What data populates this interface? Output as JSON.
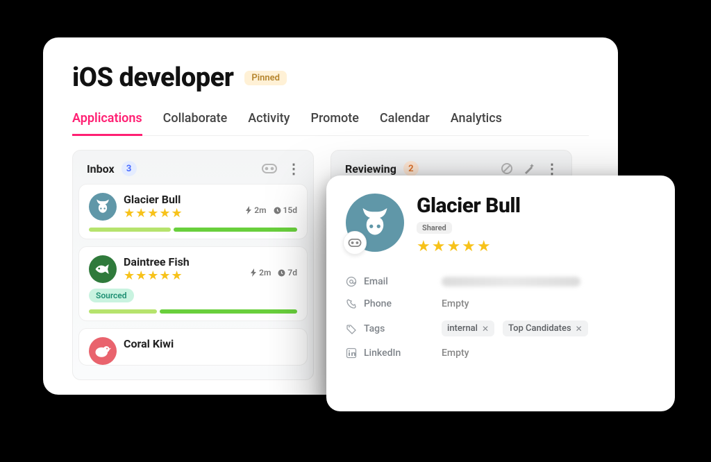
{
  "page": {
    "title": "iOS developer",
    "pinned_label": "Pinned"
  },
  "tabs": [
    "Applications",
    "Collaborate",
    "Activity",
    "Promote",
    "Calendar",
    "Analytics"
  ],
  "columns": {
    "inbox": {
      "title": "Inbox",
      "count": "3",
      "cards": [
        {
          "name": "Glacier Bull",
          "stars": 5,
          "bolt": "2m",
          "clock": "15d",
          "bar": [
            40,
            60
          ]
        },
        {
          "name": "Daintree Fish",
          "stars": 5,
          "bolt": "2m",
          "clock": "7d",
          "sourced": "Sourced",
          "bar": [
            33,
            67
          ]
        },
        {
          "name": "Coral Kiwi"
        }
      ]
    },
    "reviewing": {
      "title": "Reviewing",
      "count": "2"
    }
  },
  "detail": {
    "name": "Glacier Bull",
    "shared": "Shared",
    "fields": {
      "email_label": "Email",
      "phone_label": "Phone",
      "phone_value": "Empty",
      "tags_label": "Tags",
      "tags": [
        "internal",
        "Top Candidates"
      ],
      "linkedin_label": "LinkedIn",
      "linkedin_value": "Empty"
    }
  }
}
